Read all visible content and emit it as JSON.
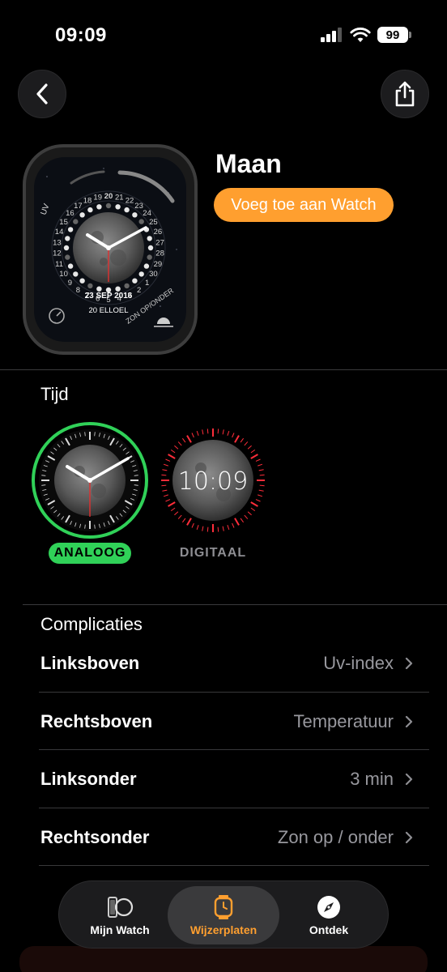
{
  "status": {
    "time": "09:09",
    "battery": "99"
  },
  "header": {
    "back_icon": "chevron-left-icon",
    "share_icon": "share-icon"
  },
  "face": {
    "title": "Maan",
    "add_button": "Voeg toe aan Watch",
    "preview": {
      "date": "23 SEP 2016",
      "moon_date": "20 ELLOEL",
      "top_left_label": "UV",
      "bottom_right_label": "ZON OP/ONDER",
      "calendar_top": "20",
      "ring_numbers": [
        "21",
        "22",
        "23",
        "24",
        "25",
        "26",
        "27",
        "28",
        "29",
        "30",
        "1",
        "2",
        "3",
        "4",
        "5",
        "6",
        "7",
        "8",
        "9",
        "10",
        "11",
        "12",
        "13",
        "14",
        "15",
        "16",
        "17",
        "18",
        "19"
      ]
    }
  },
  "time_section": {
    "title": "Tijd",
    "options": [
      {
        "label": "ANALOOG",
        "selected": true
      },
      {
        "label": "DIGITAAL",
        "selected": false,
        "display": "10:09"
      }
    ]
  },
  "complications": {
    "title": "Complicaties",
    "rows": [
      {
        "label": "Linksboven",
        "value": "Uv-index"
      },
      {
        "label": "Rechtsboven",
        "value": "Temperatuur"
      },
      {
        "label": "Linksonder",
        "value": "3 min"
      },
      {
        "label": "Rechtsonder",
        "value": "Zon op / onder"
      }
    ]
  },
  "tabbar": {
    "tabs": [
      {
        "label": "Mijn Watch",
        "icon": "watch-icon"
      },
      {
        "label": "Wijzerplaten",
        "icon": "watch-face-icon",
        "active": true
      },
      {
        "label": "Ontdek",
        "icon": "compass-icon"
      }
    ]
  },
  "colors": {
    "accent": "#ff9f2f",
    "selected": "#30d158",
    "digital_ring": "#ff2d3a"
  }
}
